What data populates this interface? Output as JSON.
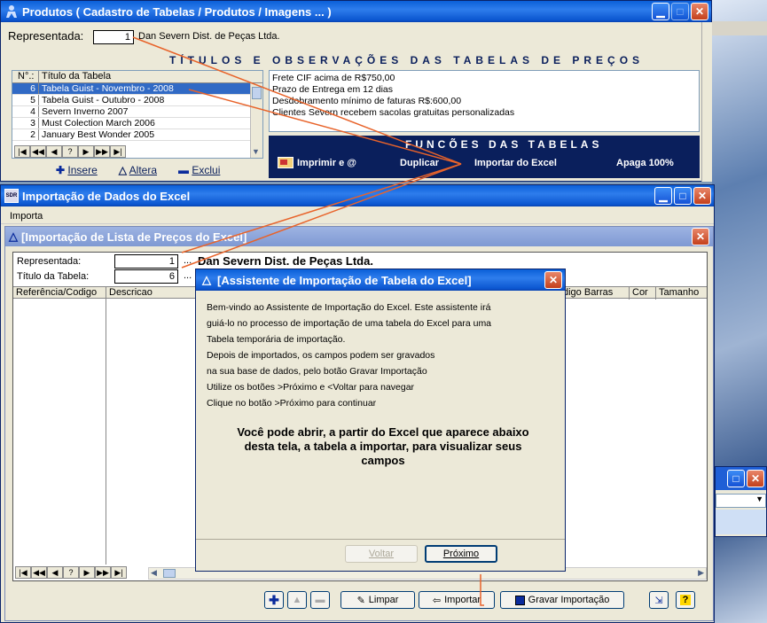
{
  "produtos_window": {
    "title": "Produtos ( Cadastro de Tabelas / Produtos / Imagens ... )",
    "representada_label": "Representada:",
    "representada_value": "1",
    "representada_name": "Dan Severn Dist. de Peças Ltda.",
    "section_title": "TÍTULOS E OBSERVAÇÕES DAS TABELAS DE PREÇOS",
    "list_headers": [
      "N°.:",
      "Título da Tabela"
    ],
    "tables": [
      {
        "num": "6",
        "title": "Tabela Guist - Novembro - 2008"
      },
      {
        "num": "5",
        "title": "Tabela Guist - Outubro - 2008"
      },
      {
        "num": "4",
        "title": "Severn Inverno 2007"
      },
      {
        "num": "3",
        "title": "Must Colection March 2006"
      },
      {
        "num": "2",
        "title": "January Best Wonder 2005"
      }
    ],
    "observations": [
      "Frete CIF acima de R$750,00",
      "Prazo de Entrega em 12 dias",
      "Desdobramento mínimo de faturas R$:600,00",
      "Clientes Severn recebem sacolas gratuitas personalizadas"
    ],
    "actions": {
      "insere": "Insere",
      "altera": "Altera",
      "exclui": "Exclui"
    },
    "funcoes_title": "FUNCÕES DAS TABELAS",
    "funcoes": {
      "imprimir": "Imprimir e @",
      "duplicar": "Duplicar",
      "importar": "Importar do Excel",
      "apaga": "Apaga 100%"
    }
  },
  "import_window": {
    "title": "Importação de Dados do Excel",
    "menu": "Importa",
    "sub_title": "[Importação de Lista de Preços do Excel]",
    "representada_label": "Representada:",
    "representada_value": "1",
    "representada_name": "Dan Severn Dist. de Peças Ltda.",
    "titulo_label": "Título da Tabela:",
    "titulo_value": "6",
    "ellipsis": "...",
    "grid_headers": [
      "Referência/Codigo",
      "Descricao",
      "digo Barras",
      "Cor",
      "Tamanho"
    ],
    "buttons": {
      "limpar": "Limpar",
      "importar": "Importar",
      "gravar": "Gravar Importação"
    }
  },
  "wizard": {
    "title": "[Assistente de Importação de Tabela do Excel]",
    "lines": [
      "Bem-vindo ao Assistente de Importação do Excel. Este assistente irá",
      "guiá-lo no processo de importação de uma tabela do Excel para uma",
      "Tabela temporária de importação.",
      "Depois de importados, os campos podem ser gravados",
      "na sua  base de dados, pelo botão Gravar Importação",
      "Utilize os botões >Próximo e <Voltar para navegar",
      "Clique no botão >Próximo para continuar"
    ],
    "bold_text": "Você pode abrir, a partir do Excel que aparece abaixo desta tela, a tabela a importar, para visualizar seus campos",
    "voltar": "Voltar",
    "proximo": "Próximo"
  },
  "colors": {
    "titlebar": "#0a5fd8",
    "dark_panel": "#0a1f5c",
    "selection": "#316ac5",
    "annotation_line": "#e8632a"
  }
}
